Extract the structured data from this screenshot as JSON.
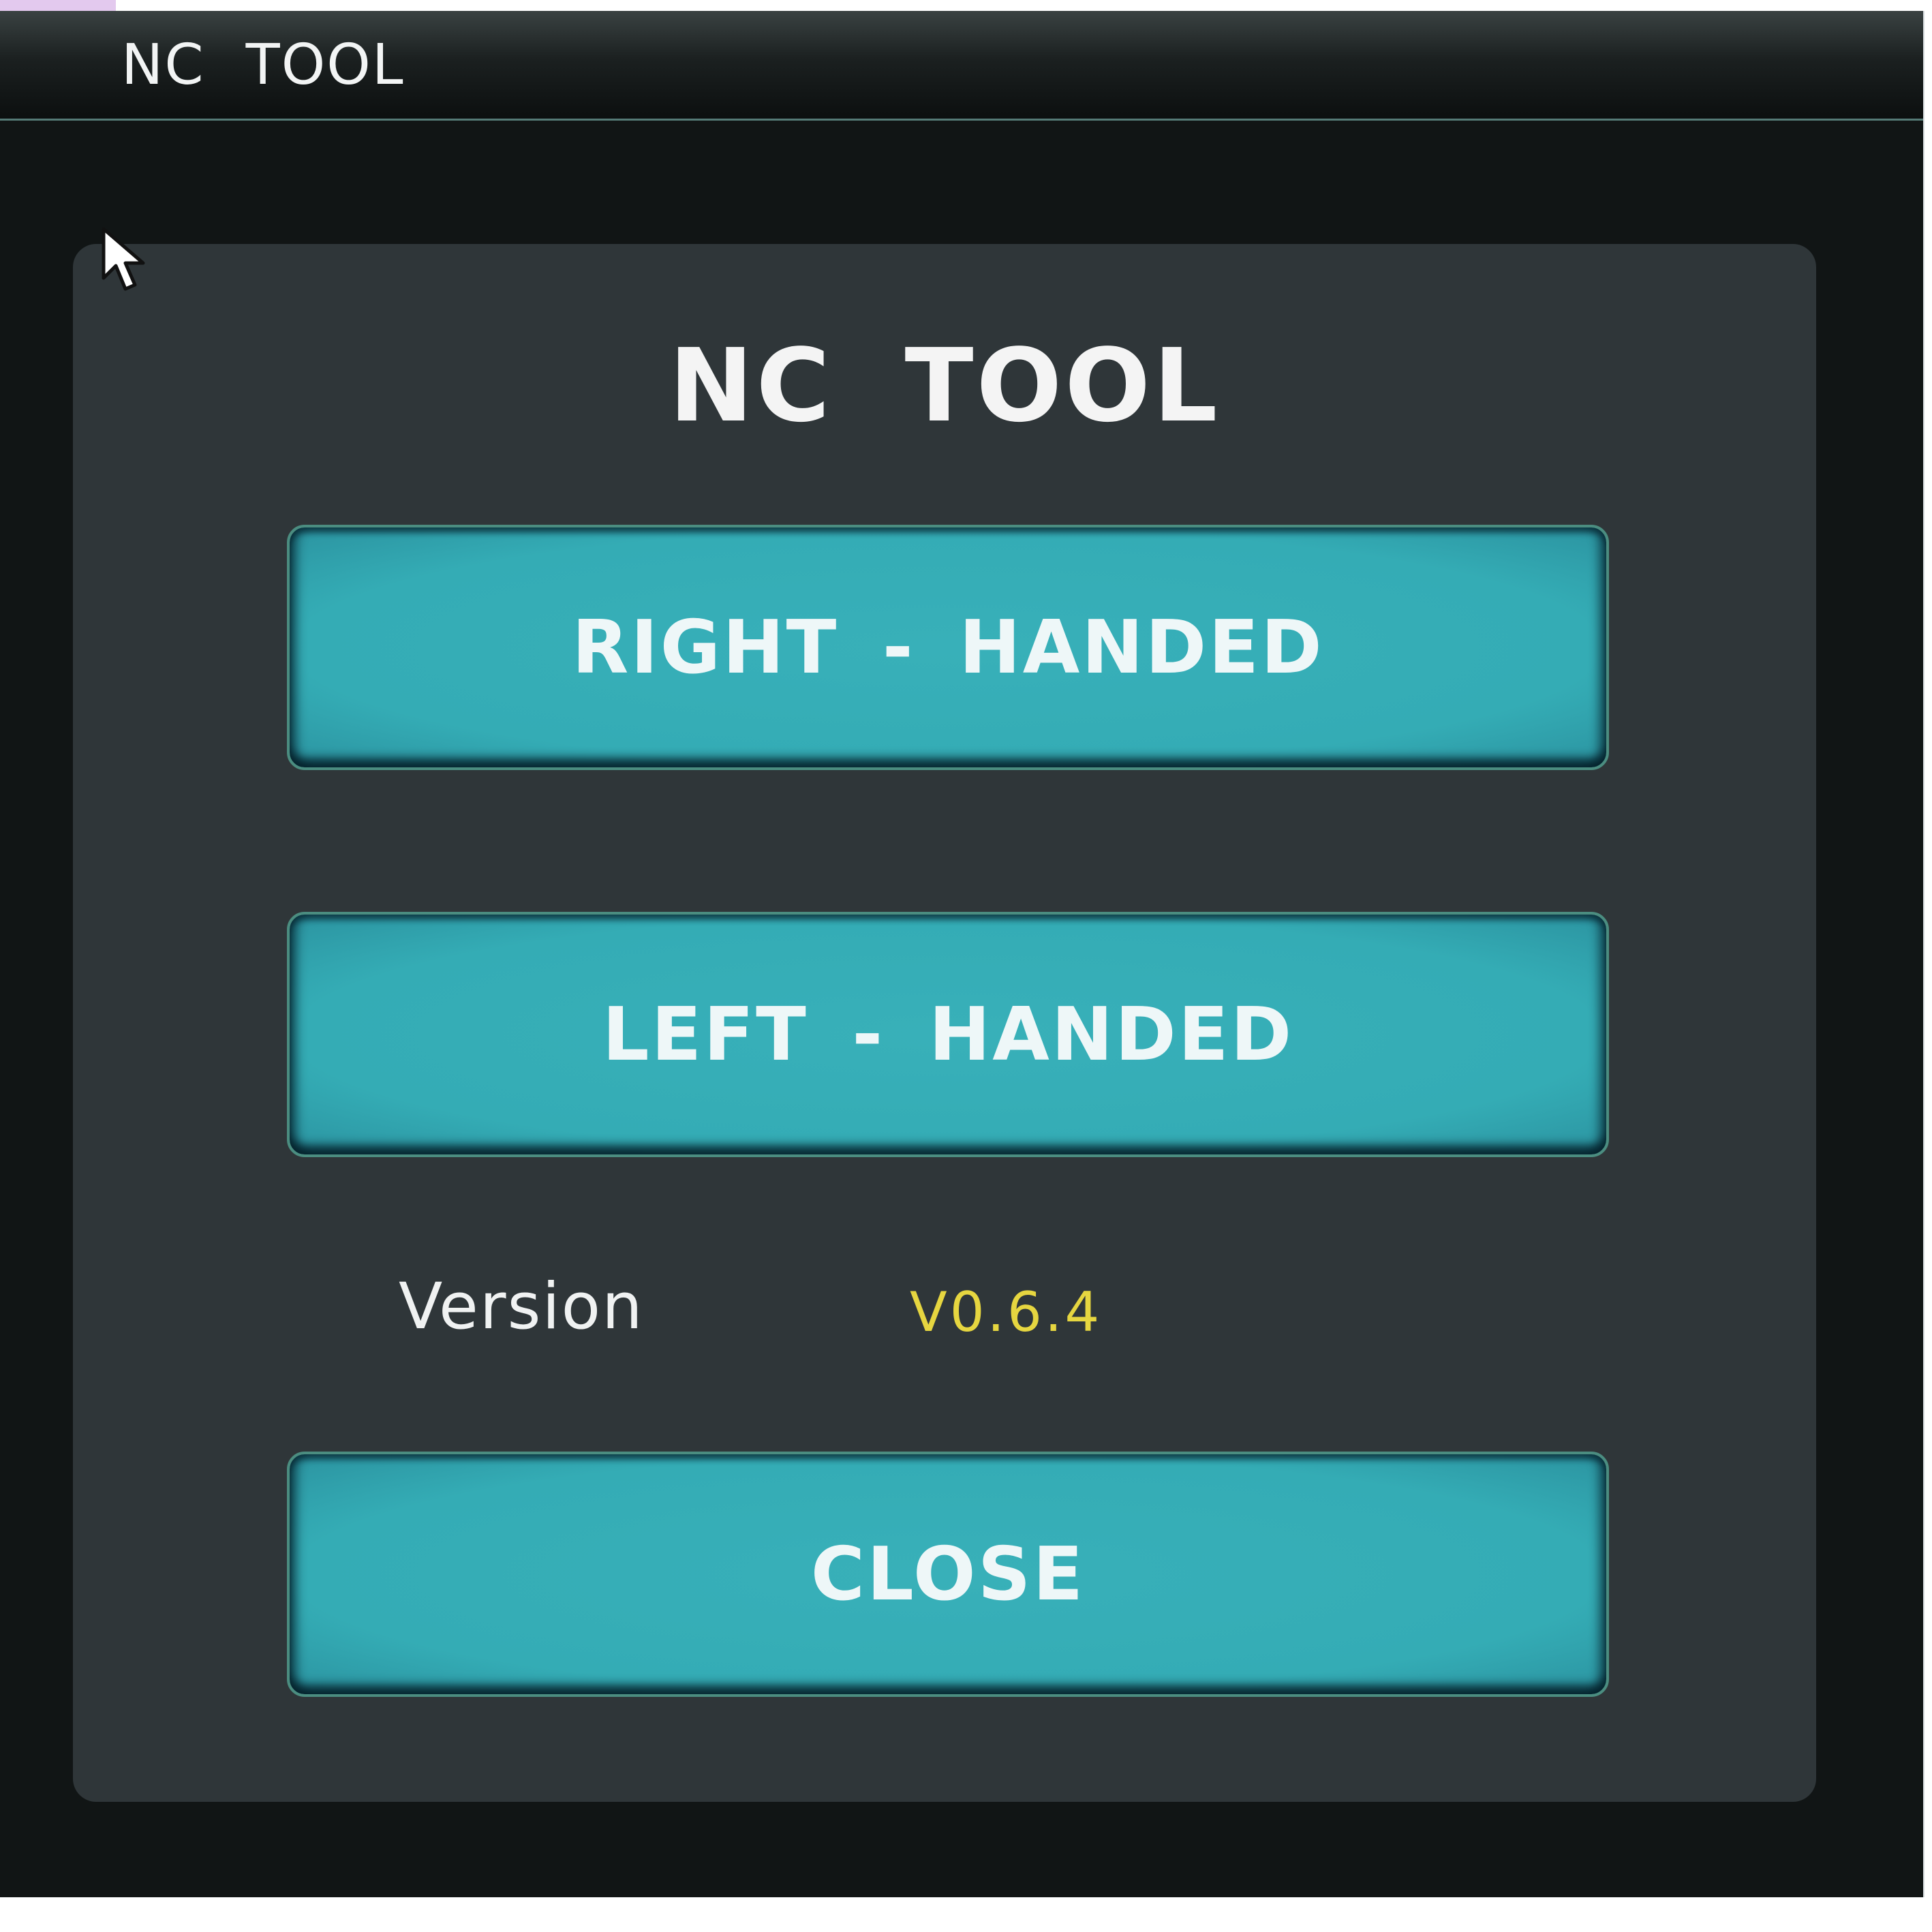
{
  "window": {
    "title": "NC TOOL"
  },
  "dialog": {
    "heading": "NC TOOL",
    "buttons": {
      "right_handed": "RIGHT - HANDED",
      "left_handed": "LEFT - HANDED",
      "close": "CLOSE"
    },
    "version": {
      "label": "Version",
      "value": "V0.6.4"
    }
  },
  "colors": {
    "window_background": "#111515",
    "panel_background": "#2f3639",
    "button_fill": "#35adb6",
    "version_value": "#e6d640",
    "text": "#f4f4f4"
  },
  "icons": {
    "cursor": "mouse-pointer-icon"
  }
}
